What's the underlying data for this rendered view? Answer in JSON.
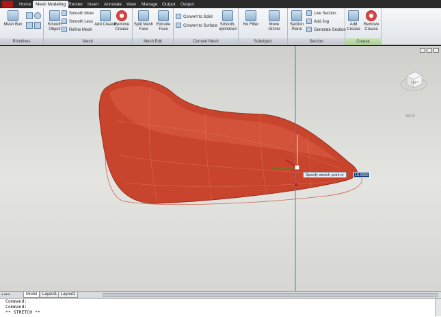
{
  "tabs": [
    "Home",
    "Mesh Modeling",
    "Render",
    "Insert",
    "Annotate",
    "View",
    "Manage",
    "Output",
    "Output"
  ],
  "active_tab": "Mesh Modeling",
  "ribbon": {
    "primitives": {
      "mesh_box": "Mesh Box",
      "title": "Primitives"
    },
    "mesh": {
      "smooth_object": "Smooth Object",
      "smooth_more": "Smooth More",
      "smooth_less": "Smooth Less",
      "refine_mesh": "Refine Mesh",
      "add_crease": "Add Crease",
      "remove_crease": "Remove Crease",
      "title": "Mesh"
    },
    "mesh_edit": {
      "split_mesh_face": "Split Mesh Face",
      "extrude_face": "Extrude Face",
      "title": "Mesh Edit"
    },
    "convert_mesh": {
      "convert_to_solid": "Convert to Solid",
      "convert_to_surface": "Convert to Surface",
      "smooth_optimized": "Smooth, optimized",
      "title": "Convert Mesh"
    },
    "subobject": {
      "no_filter": "No Filter",
      "move_gizmo": "Move Gizmo",
      "title": "Subobject"
    },
    "section": {
      "section_plane": "Section Plane",
      "live_section": "Live Section",
      "add_jog": "Add Jog",
      "generate_section": "Generate Section",
      "title": "Section"
    },
    "crease": {
      "add_crease": "Add Crease",
      "remove_crease": "Remove Crease",
      "title": "Crease"
    }
  },
  "viewport": {
    "viewcube_label": "LEFT",
    "wcs_label": "WCS",
    "dynamic_prompt": "Specify stretch point or",
    "dynamic_value": "15.2668"
  },
  "layout_tabs": [
    "Model",
    "Layout1",
    "Layout2"
  ],
  "command_lines": [
    "Command:",
    "Command:",
    "** STRETCH **"
  ],
  "colors": {
    "mesh": "#c8442c",
    "background": "#dcdcd8",
    "axis_blue": "#3a7fd0"
  }
}
